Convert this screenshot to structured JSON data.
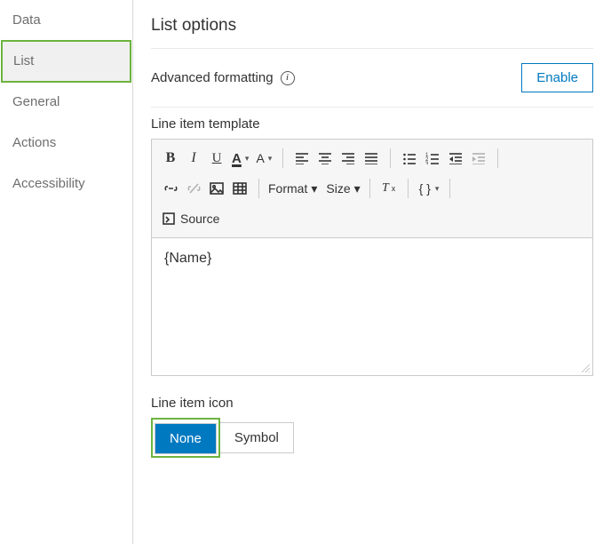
{
  "sidebar": {
    "items": [
      {
        "label": "Data"
      },
      {
        "label": "List"
      },
      {
        "label": "General"
      },
      {
        "label": "Actions"
      },
      {
        "label": "Accessibility"
      }
    ],
    "active_index": 1
  },
  "page": {
    "title": "List options"
  },
  "advanced": {
    "label": "Advanced formatting",
    "enable_label": "Enable"
  },
  "template": {
    "label": "Line item template",
    "content": "{Name}",
    "toolbar": {
      "bold": "B",
      "italic": "I",
      "underline": "U",
      "textcolor": "A",
      "bgcolor": "A",
      "format_label": "Format",
      "size_label": "Size",
      "removeformat": "Tx",
      "braces": "{ }",
      "source_label": "Source"
    }
  },
  "icon_section": {
    "label": "Line item icon",
    "options": [
      {
        "label": "None"
      },
      {
        "label": "Symbol"
      }
    ],
    "selected_index": 0
  }
}
